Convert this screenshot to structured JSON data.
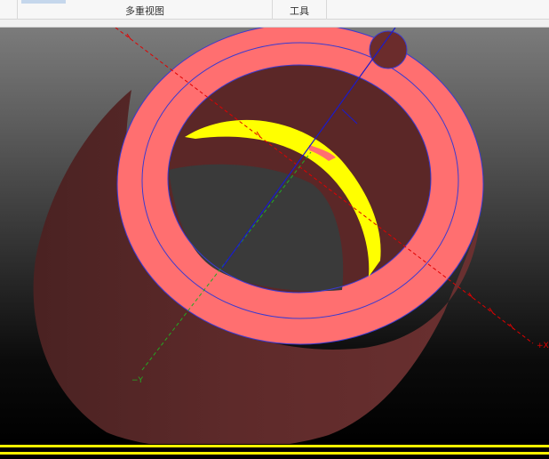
{
  "ribbon": {
    "groups": [
      {
        "label": ""
      },
      {
        "label": "多重视图"
      },
      {
        "label": "工具"
      }
    ]
  },
  "viewport": {
    "axis_labels": {
      "x_positive": "+X",
      "y_negative": "−Y"
    }
  },
  "colors": {
    "background_top": "#7b7b7b",
    "background_bottom": "#000000",
    "cylinder_outer": "#5e2a2a",
    "cylinder_shade": "#4a2222",
    "rim_face": "#ff6f70",
    "inner_wall": "#5b2727",
    "cross_section": "#ffff00",
    "x_axis": "#e00000",
    "y_axis": "#22aa22",
    "z_axis": "#1a1acc",
    "outline_ring": "#3a3ad0",
    "status_stripe": "#fff200"
  }
}
